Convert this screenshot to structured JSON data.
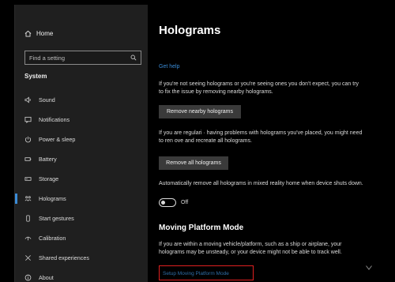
{
  "sidebar": {
    "home_label": "Home",
    "search_placeholder": "Find a setting",
    "section_title": "System",
    "items": [
      {
        "label": "Sound",
        "icon": "speaker-icon"
      },
      {
        "label": "Notifications",
        "icon": "notification-icon"
      },
      {
        "label": "Power & sleep",
        "icon": "power-icon"
      },
      {
        "label": "Battery",
        "icon": "battery-icon"
      },
      {
        "label": "Storage",
        "icon": "storage-icon"
      },
      {
        "label": "Holograms",
        "icon": "holograms-icon",
        "active": true
      },
      {
        "label": "Start gestures",
        "icon": "gesture-icon"
      },
      {
        "label": "Calibration",
        "icon": "calibration-icon"
      },
      {
        "label": "Shared experiences",
        "icon": "shared-icon"
      },
      {
        "label": "About",
        "icon": "info-icon"
      }
    ]
  },
  "main": {
    "title": "Holograms",
    "help_link": "Get help",
    "para1": "If you're not seeing holograms or you're seeing ones you don't expect, you can try to fix the issue by removing nearby holograms.",
    "remove_nearby_button": "Remove nearby holograms",
    "para2": "If you are regulari · having problems with holograms you've placed, you might need to ren ove and recreate all holograms.",
    "remove_all_button": "Remove all holograms",
    "para3": "Automatically remove all holograms in mixed reality home when device shuts down.",
    "toggle_label": "Off",
    "section2_title": "Moving Platform Mode",
    "para4": "If you are within a moving vehicle/platform, such as a ship or airplane, your holograms may be unsteady, or your device might not be able to track well.",
    "setup_link": "Setup Moving Platform Mode"
  },
  "colors": {
    "accent": "#3a8bd6",
    "highlight_box": "#e02020",
    "sidebar_bg": "#1f1f1f",
    "button_bg": "#3a3a3a"
  }
}
